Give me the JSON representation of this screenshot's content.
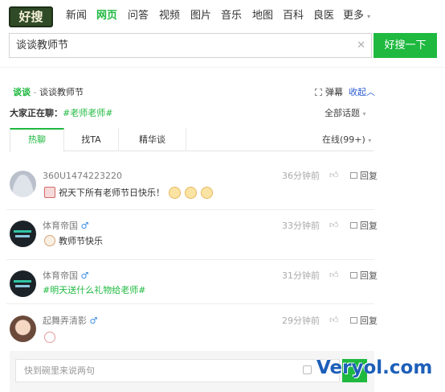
{
  "header": {
    "logo_text": "好搜",
    "nav": [
      {
        "label": "新闻",
        "active": false
      },
      {
        "label": "网页",
        "active": true
      },
      {
        "label": "问答",
        "active": false
      },
      {
        "label": "视频",
        "active": false
      },
      {
        "label": "图片",
        "active": false
      },
      {
        "label": "音乐",
        "active": false
      },
      {
        "label": "地图",
        "active": false
      },
      {
        "label": "百科",
        "active": false
      },
      {
        "label": "良医",
        "active": false
      }
    ],
    "more_label": "更多",
    "more_caret": "▾"
  },
  "search": {
    "query": "谈谈教师节",
    "clear_glyph": "✕",
    "button_label": "好搜一下"
  },
  "topic": {
    "prefix": "谈谈",
    "separator": " - ",
    "title": "谈谈教师节",
    "danmu_label": "弹幕",
    "collapse_label": "收起",
    "collapse_caret": "︿",
    "chatting_label": "大家正在聊：",
    "hashtag": "#老师老师#",
    "all_topics_label": "全部话题",
    "caret": "▾"
  },
  "tabs": [
    {
      "label": "热聊",
      "active": true
    },
    {
      "label": "找TA",
      "active": false
    },
    {
      "label": "精华谈",
      "active": false
    }
  ],
  "online_label": "在线(99+)",
  "messages": [
    {
      "user": "360U1474223220",
      "male": false,
      "time": "36分钟前",
      "text": "祝天下所有老师节日快乐！",
      "emoji_count": 3,
      "green": false,
      "reply_label": "回复"
    },
    {
      "user": "体育帝国",
      "male": true,
      "time": "33分钟前",
      "text": "教师节快乐",
      "emoji_count": 0,
      "green": false,
      "reply_label": "回复"
    },
    {
      "user": "体育帝国",
      "male": true,
      "time": "31分钟前",
      "text": "#明天送什么礼物给老师#",
      "emoji_count": 0,
      "green": true,
      "reply_label": "回复"
    },
    {
      "user": "起舞弄清影",
      "male": true,
      "time": "29分钟前",
      "text": "",
      "emoji_count": 0,
      "green": false,
      "reply_label": "回复"
    }
  ],
  "male_glyph": "♂",
  "input": {
    "placeholder": "快到碗里来说两句"
  },
  "watermark": "Veryol.com",
  "colors": {
    "accent": "#1fb940",
    "link": "#2a5bd0",
    "male": "#3b8be0"
  }
}
